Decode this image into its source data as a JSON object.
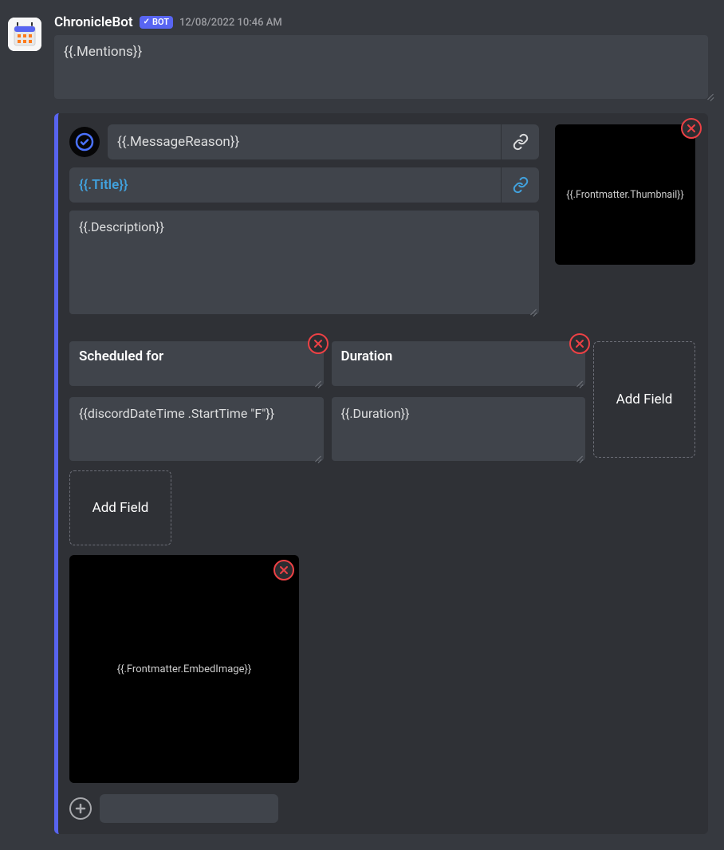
{
  "author": "ChronicleBot",
  "bot_tag": "BOT",
  "timestamp": "12/08/2022 10:46 AM",
  "mentions_value": "{{.Mentions}}",
  "embed": {
    "author_text": "{{.MessageReason}}",
    "title_text": "{{.Title}}",
    "description": "{{.Description}}",
    "thumbnail_label": "{{.Frontmatter.Thumbnail}}",
    "fields": [
      {
        "name": "Scheduled for",
        "value": "{{discordDateTime .StartTime \"F\"}}"
      },
      {
        "name": "Duration",
        "value": "{{.Duration}}"
      }
    ],
    "add_field_label": "Add Field",
    "image_label": "{{.Frontmatter.EmbedImage}}",
    "footer_text": ""
  },
  "colors": {
    "accent": "#5865f2",
    "danger": "#ec4145"
  }
}
